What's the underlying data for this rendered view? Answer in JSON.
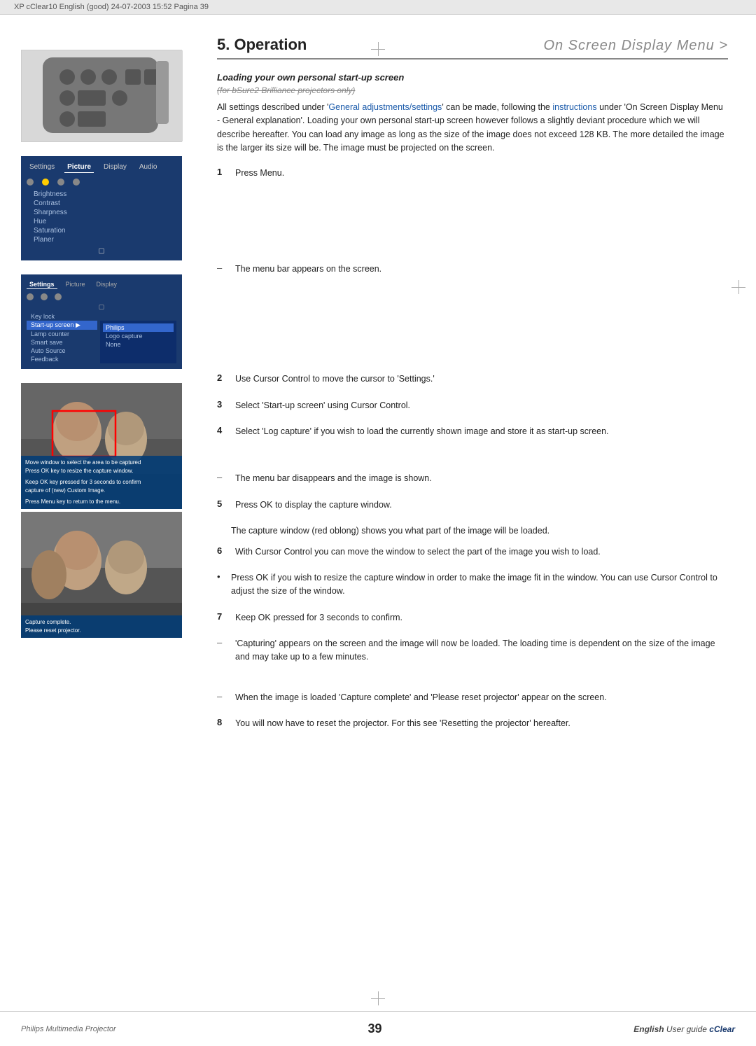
{
  "header": {
    "text": "XP cClear10 English (good)  24-07-2003  15:52  Pagina 39"
  },
  "page": {
    "chapter": "5. Operation",
    "subtitle": "On Screen Display Menu >",
    "section_title": "Loading your own personal start-up screen",
    "subtitle_strikethrough": "(for bSure2 Brilliance projectors only)",
    "intro": "All settings described under 'General adjustments/settings' can be made, following the instructions under 'On Screen Display Menu - General explanation'. Loading your own personal start-up screen however follows a slightly deviant procedure which we will describe hereafter. You can load any image as long as the size of the image does not exceed 128 KB. The more detailed the image is the larger its size will be. The image must be projected on the screen.",
    "steps": [
      {
        "num": "1",
        "text": "Press Menu."
      },
      {
        "num": "2",
        "text": "Use Cursor Control to move the cursor to 'Settings.'"
      },
      {
        "num": "3",
        "text": "Select 'Start-up screen' using Cursor Control."
      },
      {
        "num": "4",
        "text": "Select 'Log capture' if you wish to load the currently shown image and store it as start-up screen."
      },
      {
        "num": "5",
        "text": "Press OK to display the capture window."
      },
      {
        "num": "6",
        "text": "With Cursor Control you can move the window to select the part of the image you wish to load."
      },
      {
        "num": "7",
        "text": "Keep OK pressed for 3 seconds to confirm."
      },
      {
        "num": "8",
        "text": "You will now have to reset the projector. For this see 'Resetting the projector' hereafter."
      }
    ],
    "dashes": [
      {
        "text": "The menu bar appears on the screen."
      },
      {
        "text": "The menu bar disappears and the image is shown."
      },
      {
        "text": "'Capturing' appears on the screen and the image will now be loaded. The loading time is dependent on the size of the image and may take up to a few minutes."
      },
      {
        "text": "When the image is loaded 'Capture complete' and 'Please reset projector' appear on the screen."
      }
    ],
    "bullets": [
      {
        "text": "Press OK if you wish to resize the capture window in order to make the image fit in the window. You can use Cursor Control to adjust the size of the window."
      }
    ]
  },
  "menu_picture": {
    "tabs": [
      "Settings",
      "Picture",
      "Display",
      "Audio"
    ],
    "active_tab": "Picture",
    "items": [
      "Brightness",
      "Contrast",
      "Sharpness",
      "Hue",
      "Saturation",
      "Planer"
    ]
  },
  "menu_settings": {
    "tabs": [
      "Settings",
      "Picture",
      "Display"
    ],
    "active_tab": "Settings",
    "items": [
      "Key lock",
      "Start-up screen",
      "Lamp counter",
      "Smart save",
      "Auto Source",
      "Feedback"
    ],
    "highlighted": "Start-up screen",
    "submenu": {
      "col1": [
        "Philips",
        "Logo capture",
        "None"
      ],
      "highlighted": "Philips"
    }
  },
  "photo_overlay_1": {
    "lines": [
      "Move window to select the area to be captured",
      "Press OK key to resize the capture window.",
      "",
      "Keep OK key pressed for 3 seconds to confirm",
      "capture of (new) Custom Image.",
      "",
      "Press Menu key to return to the menu."
    ]
  },
  "photo_overlay_2": {
    "lines": [
      "Capture complete.",
      "Please reset projector."
    ]
  },
  "footer": {
    "left": "Philips Multimedia Projector",
    "center": "39",
    "right_lang": "English",
    "right_guide": " User guide  ",
    "right_brand": "cClear"
  }
}
